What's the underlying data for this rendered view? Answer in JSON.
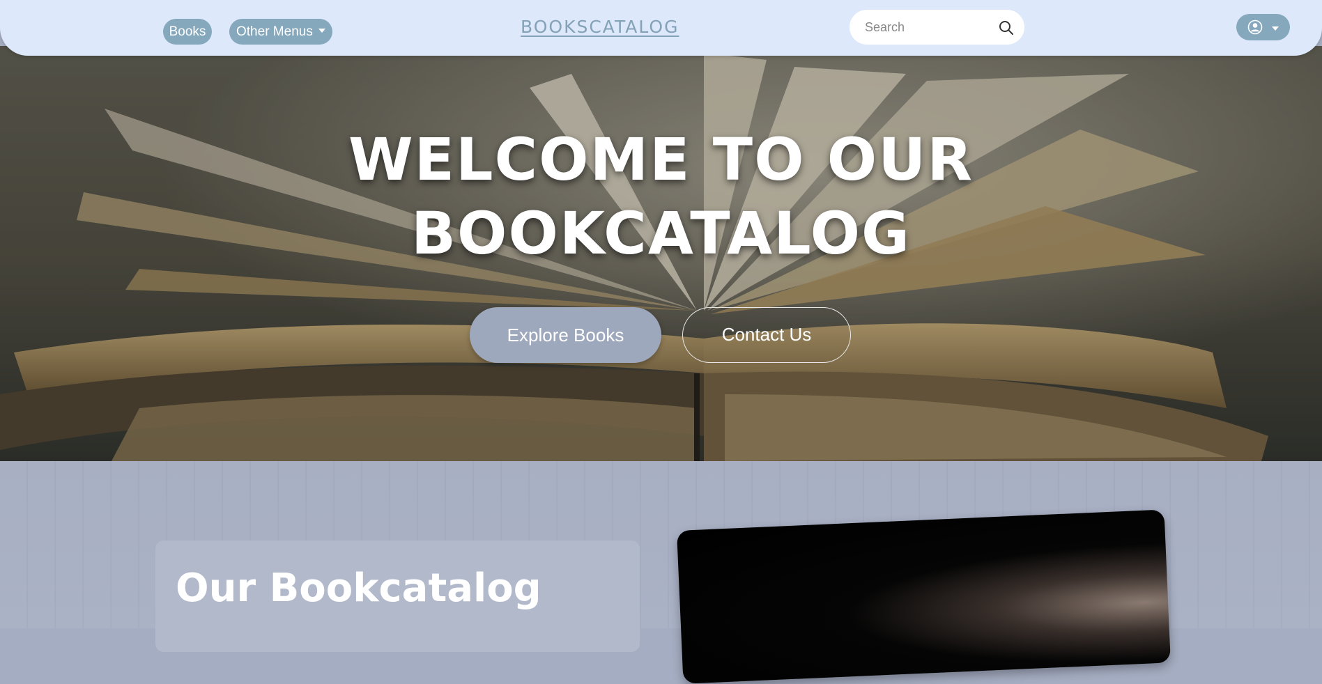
{
  "nav": {
    "books_label": "Books",
    "other_menus_label": "Other Menus",
    "brand": "BOOKSCATALOG",
    "search_placeholder": "Search"
  },
  "hero": {
    "title_line1": "WELCOME TO OUR",
    "title_line2": "BOOKCATALOG",
    "explore_button": "Explore Books",
    "contact_button": "Contact Us"
  },
  "about": {
    "title": "Our Bookcatalog"
  },
  "icons": {
    "search": "search-icon",
    "user": "user-circle-icon",
    "dropdown": "chevron-down-icon"
  },
  "colors": {
    "nav_bg": "#dde8fa",
    "pill": "#86a8bd",
    "brand": "#84a2b7",
    "section_bg": "#a6adc2",
    "explore_btn": "#9ea8bd"
  }
}
